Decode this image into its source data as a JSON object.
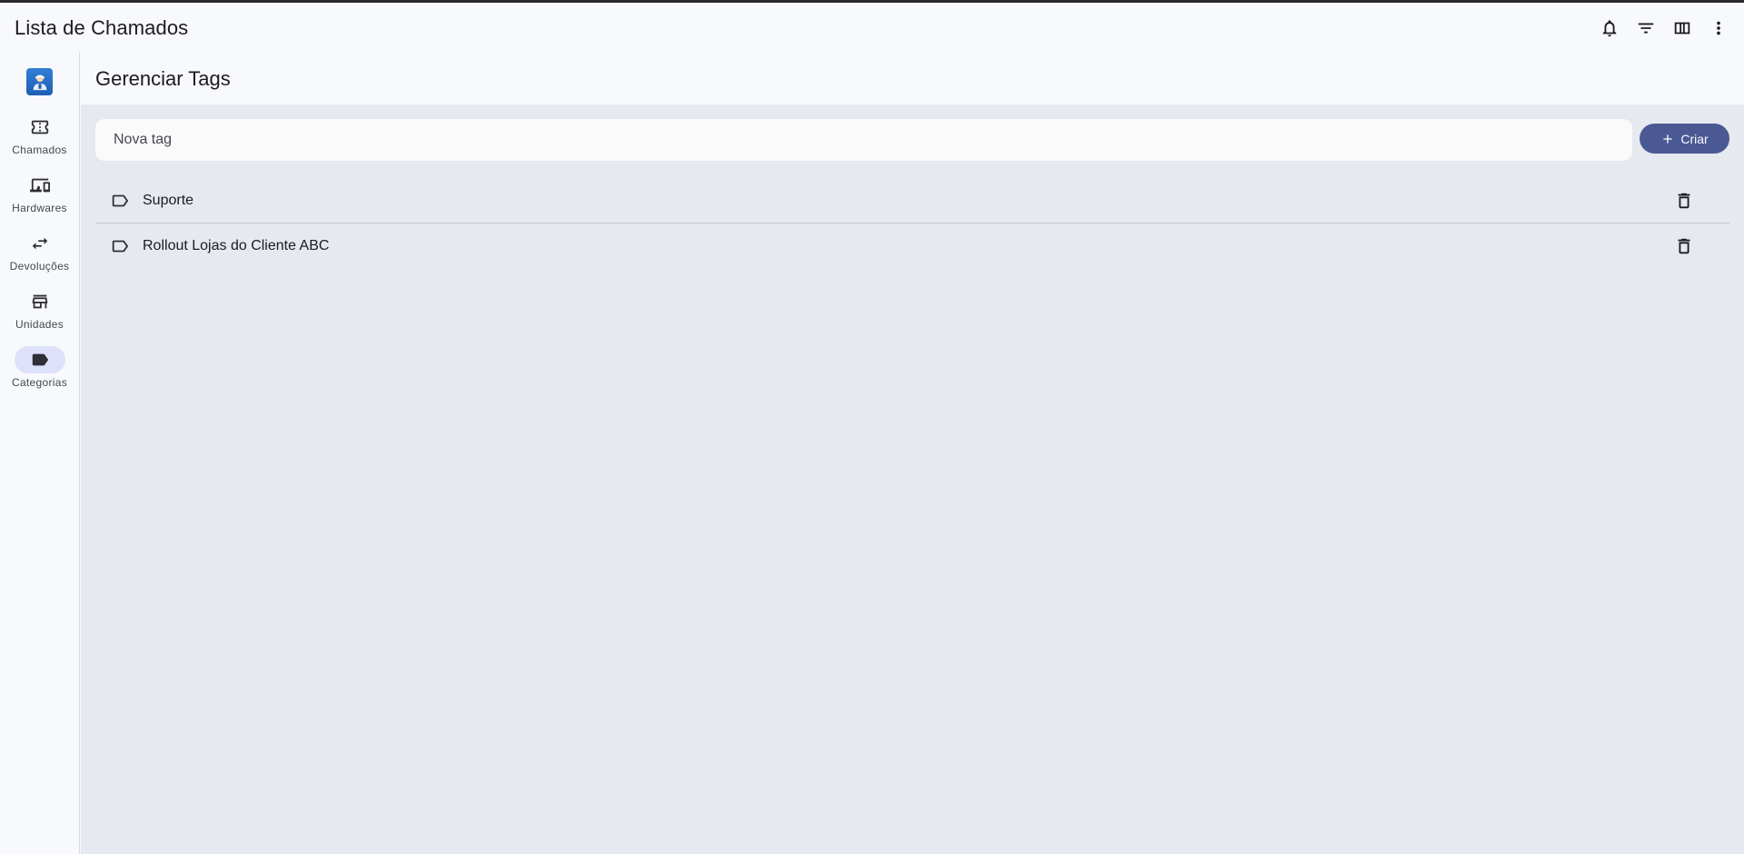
{
  "appbar": {
    "title": "Lista de Chamados",
    "actions": [
      {
        "icon": "bell-icon"
      },
      {
        "icon": "filter-icon"
      },
      {
        "icon": "columns-icon"
      },
      {
        "icon": "more-vert-icon"
      }
    ]
  },
  "rail": {
    "logo_icon": "app-logo-icon",
    "items": [
      {
        "label": "Chamados",
        "icon": "ticket-icon",
        "active": false
      },
      {
        "label": "Hardwares",
        "icon": "devices-icon",
        "active": false
      },
      {
        "label": "Devoluções",
        "icon": "swap-icon",
        "active": false
      },
      {
        "label": "Unidades",
        "icon": "store-icon",
        "active": false
      },
      {
        "label": "Categorias",
        "icon": "label-icon",
        "active": true
      }
    ]
  },
  "main": {
    "title": "Gerenciar Tags",
    "new_tag": {
      "placeholder": "Nova tag",
      "value": ""
    },
    "create_button": {
      "label": "Criar",
      "icon": "add-icon"
    },
    "tags": [
      {
        "name": "Suporte"
      },
      {
        "name": "Rollout Lojas do Cliente ABC"
      }
    ]
  },
  "colors": {
    "accent": "#4a5894",
    "active_pill": "#dde1f9",
    "content_bg": "#e6e9ef",
    "surface": "#f8f9fc"
  }
}
